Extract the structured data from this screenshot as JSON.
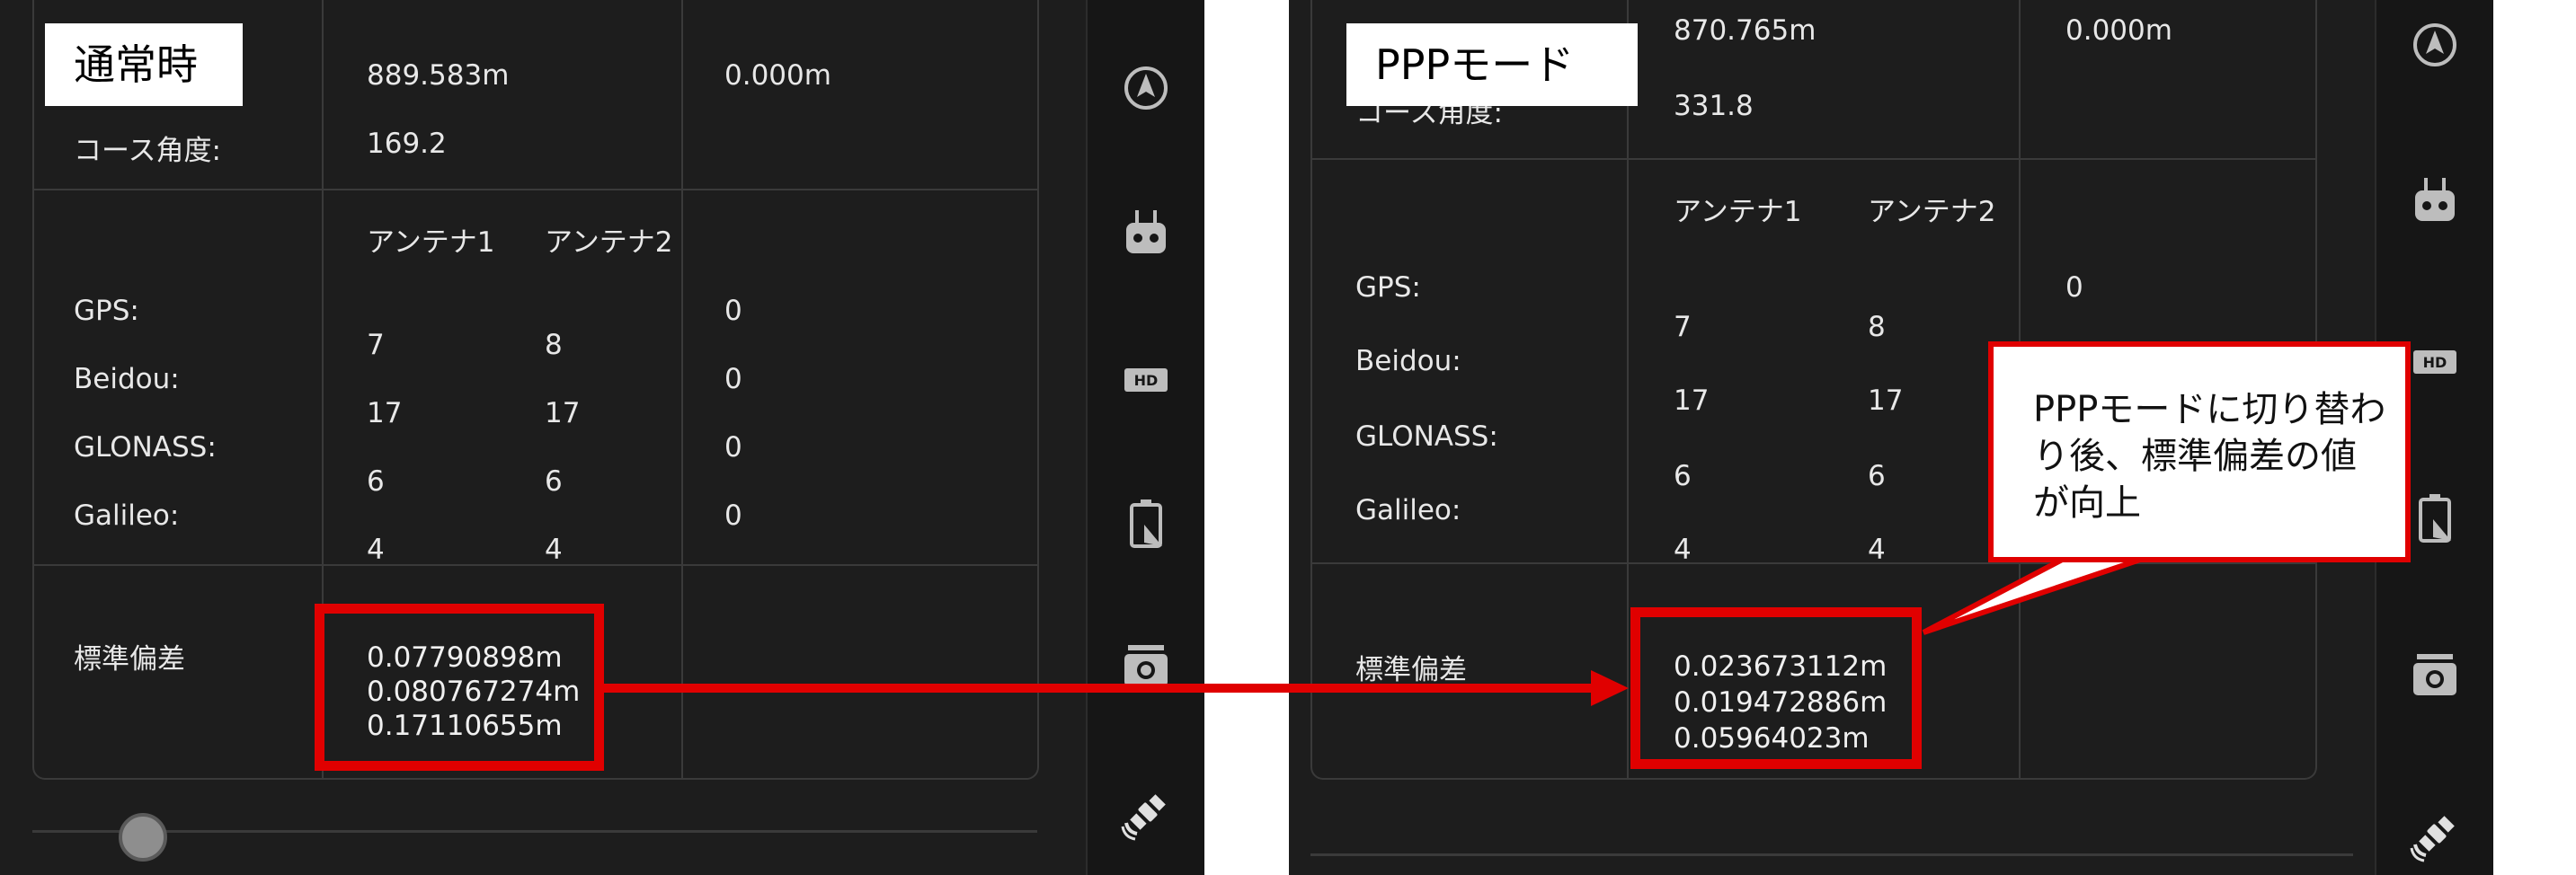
{
  "left": {
    "mode_label": "通常時",
    "top_values": [
      "889.583m",
      "0.000m"
    ],
    "course_label": "コース角度:",
    "course_value": "169.2",
    "antenna1": "アンテナ1",
    "antenna2": "アンテナ2",
    "satellites": [
      {
        "name": "GPS:",
        "a1": "7",
        "a2": "8",
        "c3": "0"
      },
      {
        "name": "Beidou:",
        "a1": "17",
        "a2": "17",
        "c3": "0"
      },
      {
        "name": "GLONASS:",
        "a1": "6",
        "a2": "6",
        "c3": "0"
      },
      {
        "name": "Galileo:",
        "a1": "4",
        "a2": "4",
        "c3": "0"
      }
    ],
    "std_label": "標準偏差",
    "std_values": [
      "0.07790898m",
      "0.080767274m",
      "0.17110655m"
    ]
  },
  "right": {
    "mode_label": "PPPモード",
    "top_values": [
      "870.765m",
      "0.000m"
    ],
    "course_label": "コース角度:",
    "course_value": "331.8",
    "antenna1": "アンテナ1",
    "antenna2": "アンテナ2",
    "satellites": [
      {
        "name": "GPS:",
        "a1": "7",
        "a2": "8",
        "c3": "0"
      },
      {
        "name": "Beidou:",
        "a1": "17",
        "a2": "17",
        "c3": ""
      },
      {
        "name": "GLONASS:",
        "a1": "6",
        "a2": "6",
        "c3": ""
      },
      {
        "name": "Galileo:",
        "a1": "4",
        "a2": "4",
        "c3": ""
      }
    ],
    "std_label": "標準偏差",
    "std_values": [
      "0.023673112m",
      "0.019472886m",
      "0.05964023m"
    ]
  },
  "callout": "PPPモードに切り替わり後、標準偏差の値が向上",
  "sidebar_icons": [
    "compass-icon",
    "remote-controller-icon",
    "hd-icon",
    "battery-icon",
    "camera-icon",
    "satellite-icon"
  ],
  "colors": {
    "highlight": "#e00000",
    "panel_bg": "#1d1d1d",
    "text": "#e8e8e8"
  }
}
